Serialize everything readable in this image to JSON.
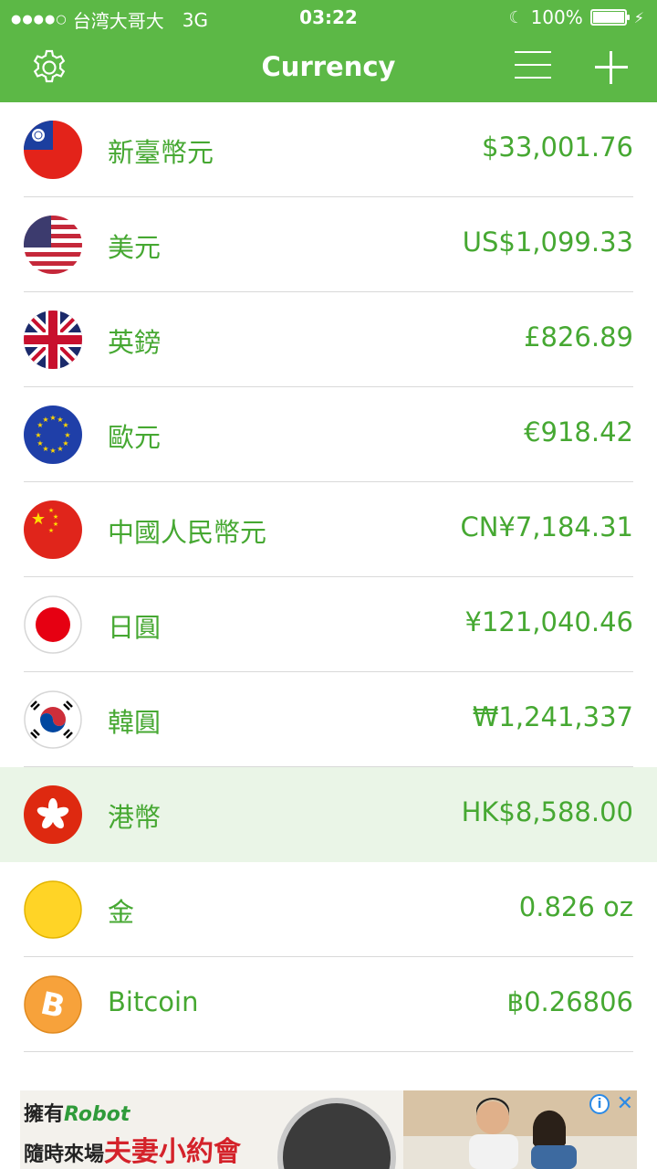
{
  "status_bar": {
    "carrier": "台湾大哥大",
    "network": "3G",
    "time": "03:22",
    "battery": "100%"
  },
  "nav": {
    "title": "Currency",
    "settings_icon": "gear-icon",
    "menu_icon": "hamburger-menu-icon",
    "add_icon": "plus-icon"
  },
  "currencies": [
    {
      "name": "新臺幣元",
      "amount": "$33,001.76",
      "flag": "taiwan-flag"
    },
    {
      "name": "美元",
      "amount": "US$1,099.33",
      "flag": "usa-flag"
    },
    {
      "name": "英鎊",
      "amount": "£826.89",
      "flag": "uk-flag"
    },
    {
      "name": "歐元",
      "amount": "€918.42",
      "flag": "eu-flag"
    },
    {
      "name": "中國人民幣元",
      "amount": "CN¥7,184.31",
      "flag": "china-flag"
    },
    {
      "name": "日圓",
      "amount": "¥121,040.46",
      "flag": "japan-flag"
    },
    {
      "name": "韓圓",
      "amount": "₩1,241,337",
      "flag": "korea-flag"
    },
    {
      "name": "港幣",
      "amount": "HK$8,588.00",
      "flag": "hongkong-flag",
      "selected": true
    },
    {
      "name": "金",
      "amount": "0.826 oz",
      "flag": "gold-icon"
    },
    {
      "name": "Bitcoin",
      "amount": "฿0.26806",
      "flag": "bitcoin-icon"
    }
  ],
  "ad": {
    "line1_a": "擁有",
    "line1_brand": "Robot",
    "line2_a": "隨時來場",
    "line2_big": "夫妻小約會",
    "info_icon": "info-icon",
    "close_icon": "close-icon"
  },
  "colors": {
    "accent": "#5cb846",
    "text_green": "#46a832",
    "highlight_row": "#eaf5e7"
  }
}
